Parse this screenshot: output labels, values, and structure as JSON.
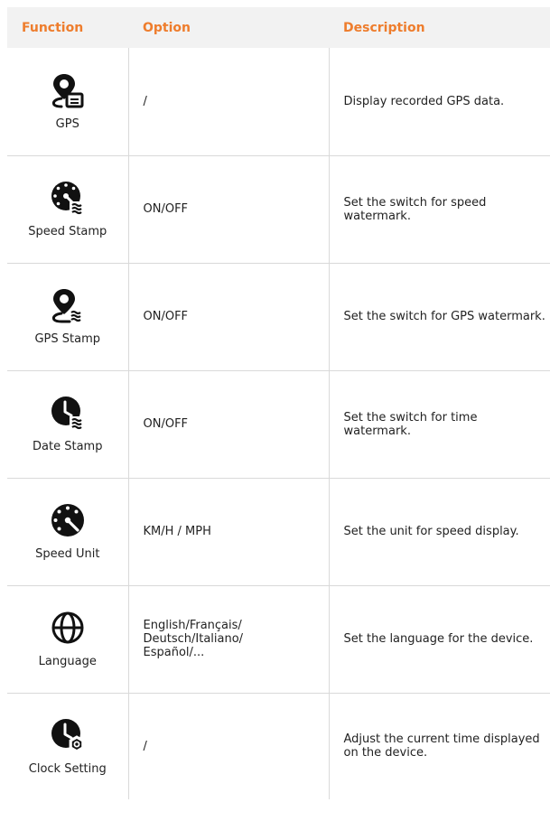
{
  "headers": {
    "function": "Function",
    "option": "Option",
    "description": "Description"
  },
  "accent_color": "#ee7d2d",
  "rows": [
    {
      "function": "GPS",
      "icon": "gps-data-icon",
      "option": "/",
      "description": "Display recorded GPS data."
    },
    {
      "function": "Speed Stamp",
      "icon": "speed-stamp-icon",
      "option": "ON/OFF",
      "description": "Set the switch for speed watermark."
    },
    {
      "function": "GPS Stamp",
      "icon": "gps-stamp-icon",
      "option": "ON/OFF",
      "description": "Set the switch for GPS watermark."
    },
    {
      "function": "Date Stamp",
      "icon": "date-stamp-icon",
      "option": "ON/OFF",
      "description": "Set the switch for time watermark."
    },
    {
      "function": "Speed Unit",
      "icon": "speedometer-icon",
      "option": "KM/H / MPH",
      "description": "Set the unit for speed display."
    },
    {
      "function": "Language",
      "icon": "globe-icon",
      "option": "English/Français/\nDeutsch/Italiano/\nEspañol/...",
      "description": "Set the language for the device."
    },
    {
      "function": "Clock Setting",
      "icon": "clock-settings-icon",
      "option": "/",
      "description": "Adjust the current time displayed on the device."
    }
  ]
}
